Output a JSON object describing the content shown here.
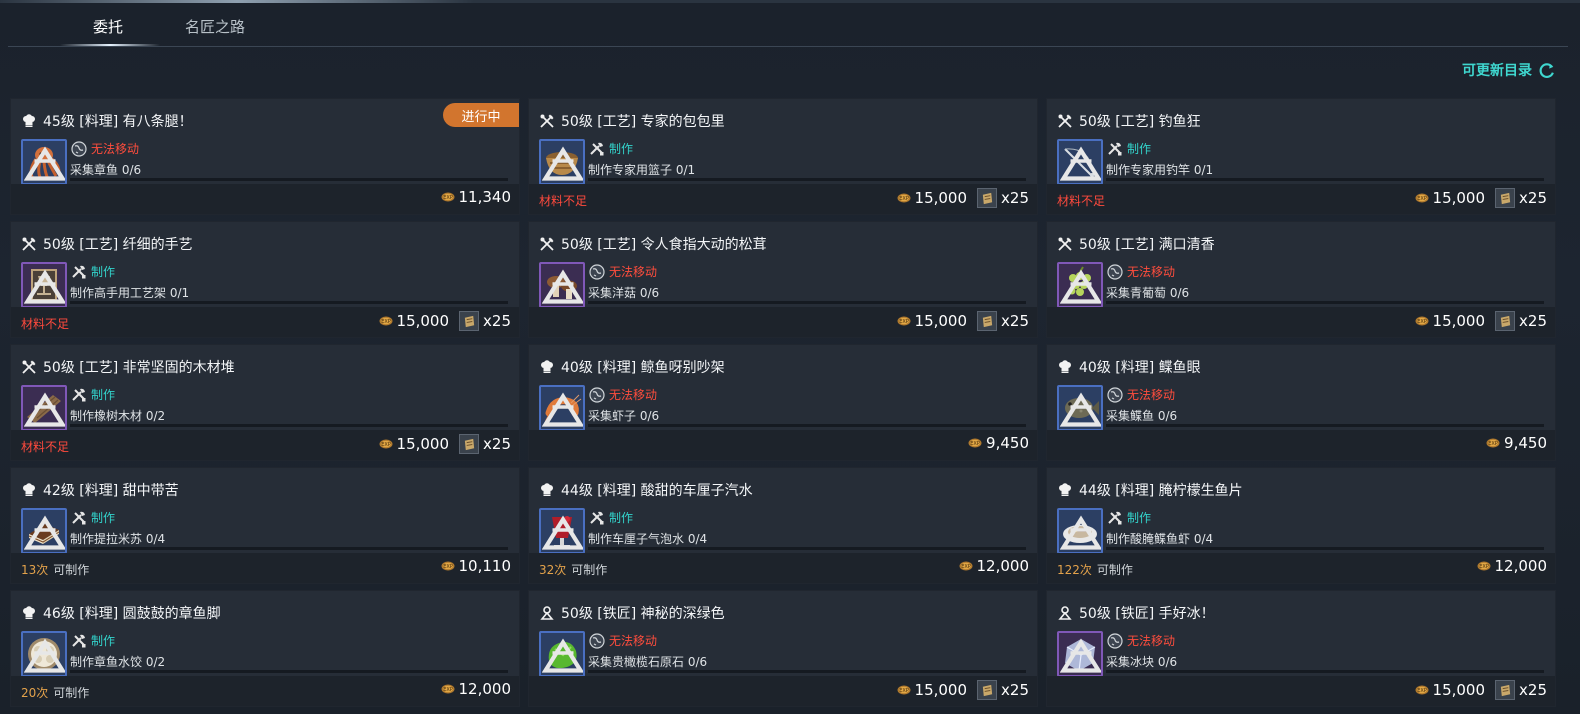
{
  "tabs": [
    {
      "label": "委托",
      "active": true
    },
    {
      "label": "名匠之路",
      "active": false
    }
  ],
  "refresh_label": "可更新目录",
  "colors": {
    "teal": "#33d3cb",
    "red": "#ff4d3d",
    "orange_badge": "#d2752e",
    "gold": "#e3a24b"
  },
  "cards": [
    {
      "type_icon": "chef-hat-icon",
      "title": "45级  [料理] 有八条腿！",
      "badge": "进行中",
      "item_icon": "octopus-icon",
      "item_color": "blue",
      "status_kind": "red",
      "status_icon": "globe-icon",
      "status": "无法移动",
      "objective": "采集章鱼 0/6",
      "left_red": "",
      "count": "",
      "count_label": "",
      "reward": "11,340",
      "multiplier": ""
    },
    {
      "type_icon": "crossed-tools-icon",
      "title": "50级  [工艺] 专家的包包里",
      "badge": "",
      "item_icon": "basket-icon",
      "item_color": "blue",
      "status_kind": "teal",
      "status_icon": "tools-icon",
      "status": "制作",
      "objective": "制作专家用篮子 0/1",
      "left_red": "材料不足",
      "count": "",
      "count_label": "",
      "reward": "15,000",
      "multiplier": "x25"
    },
    {
      "type_icon": "crossed-tools-icon",
      "title": "50级  [工艺] 钓鱼狂",
      "badge": "",
      "item_icon": "fishing-rod-icon",
      "item_color": "blue",
      "status_kind": "teal",
      "status_icon": "tools-icon",
      "status": "制作",
      "objective": "制作专家用钓竿 0/1",
      "left_red": "材料不足",
      "count": "",
      "count_label": "",
      "reward": "15,000",
      "multiplier": "x25"
    },
    {
      "type_icon": "crossed-tools-icon",
      "title": "50级  [工艺] 纤细的手艺",
      "badge": "",
      "item_icon": "craft-frame-icon",
      "item_color": "purple",
      "status_kind": "teal",
      "status_icon": "tools-icon",
      "status": "制作",
      "objective": "制作高手用工艺架 0/1",
      "left_red": "材料不足",
      "count": "",
      "count_label": "",
      "reward": "15,000",
      "multiplier": "x25"
    },
    {
      "type_icon": "crossed-tools-icon",
      "title": "50级  [工艺] 令人食指大动的松茸",
      "badge": "",
      "item_icon": "mushroom-icon",
      "item_color": "purple",
      "status_kind": "red",
      "status_icon": "globe-icon",
      "status": "无法移动",
      "objective": "采集洋菇 0/6",
      "left_red": "",
      "count": "",
      "count_label": "",
      "reward": "15,000",
      "multiplier": "x25"
    },
    {
      "type_icon": "crossed-tools-icon",
      "title": "50级  [工艺] 满口清香",
      "badge": "",
      "item_icon": "grapes-icon",
      "item_color": "purple",
      "status_kind": "red",
      "status_icon": "globe-icon",
      "status": "无法移动",
      "objective": "采集青葡萄 0/6",
      "left_red": "",
      "count": "",
      "count_label": "",
      "reward": "15,000",
      "multiplier": "x25"
    },
    {
      "type_icon": "crossed-tools-icon",
      "title": "50级  [工艺] 非常坚固的木材堆",
      "badge": "",
      "item_icon": "timber-icon",
      "item_color": "purple",
      "status_kind": "teal",
      "status_icon": "tools-icon",
      "status": "制作",
      "objective": "制作橡树木材 0/2",
      "left_red": "材料不足",
      "count": "",
      "count_label": "",
      "reward": "15,000",
      "multiplier": "x25"
    },
    {
      "type_icon": "chef-hat-icon",
      "title": "40级  [料理] 鲸鱼呀别吵架",
      "badge": "",
      "item_icon": "shrimp-icon",
      "item_color": "blue",
      "status_kind": "red",
      "status_icon": "globe-icon",
      "status": "无法移动",
      "objective": "采集虾子 0/6",
      "left_red": "",
      "count": "",
      "count_label": "",
      "reward": "9,450",
      "multiplier": ""
    },
    {
      "type_icon": "chef-hat-icon",
      "title": "40级  [料理] 鲽鱼眼",
      "badge": "",
      "item_icon": "flatfish-icon",
      "item_color": "blue",
      "status_kind": "red",
      "status_icon": "globe-icon",
      "status": "无法移动",
      "objective": "采集鲽鱼 0/6",
      "left_red": "",
      "count": "",
      "count_label": "",
      "reward": "9,450",
      "multiplier": ""
    },
    {
      "type_icon": "chef-hat-icon",
      "title": "42级  [料理] 甜中带苦",
      "badge": "",
      "item_icon": "tiramisu-icon",
      "item_color": "blue",
      "status_kind": "teal",
      "status_icon": "tools-icon",
      "status": "制作",
      "objective": "制作提拉米苏 0/4",
      "left_red": "",
      "count": "13次",
      "count_label": "可制作",
      "reward": "10,110",
      "multiplier": ""
    },
    {
      "type_icon": "chef-hat-icon",
      "title": "44级  [料理] 酸甜的车厘子汽水",
      "badge": "",
      "item_icon": "soda-icon",
      "item_color": "blue",
      "status_kind": "teal",
      "status_icon": "tools-icon",
      "status": "制作",
      "objective": "制作车厘子气泡水 0/4",
      "left_red": "",
      "count": "32次",
      "count_label": "可制作",
      "reward": "12,000",
      "multiplier": ""
    },
    {
      "type_icon": "chef-hat-icon",
      "title": "44级  [料理] 腌柠檬生鱼片",
      "badge": "",
      "item_icon": "sashimi-icon",
      "item_color": "blue",
      "status_kind": "teal",
      "status_icon": "tools-icon",
      "status": "制作",
      "objective": "制作酸腌鲽鱼虾 0/4",
      "left_red": "",
      "count": "122次",
      "count_label": "可制作",
      "reward": "12,000",
      "multiplier": ""
    },
    {
      "type_icon": "chef-hat-icon",
      "title": "46级  [料理] 圆鼓鼓的章鱼脚",
      "badge": "",
      "item_icon": "dumplings-icon",
      "item_color": "blue",
      "status_kind": "teal",
      "status_icon": "tools-icon",
      "status": "制作",
      "objective": "制作章鱼水饺 0/2",
      "left_red": "",
      "count": "20次",
      "count_label": "可制作",
      "reward": "12,000",
      "multiplier": ""
    },
    {
      "type_icon": "anvil-icon",
      "title": "50级  [铁匠] 神秘的深绿色",
      "badge": "",
      "item_icon": "olivine-ore-icon",
      "item_color": "blue",
      "status_kind": "red",
      "status_icon": "globe-icon",
      "status": "无法移动",
      "objective": "采集贵橄榄石原石 0/6",
      "left_red": "",
      "count": "",
      "count_label": "",
      "reward": "15,000",
      "multiplier": "x25"
    },
    {
      "type_icon": "anvil-icon",
      "title": "50级  [铁匠] 手好冰！",
      "badge": "",
      "item_icon": "ice-block-icon",
      "item_color": "purple",
      "status_kind": "red",
      "status_icon": "globe-icon",
      "status": "无法移动",
      "objective": "采集冰块 0/6",
      "left_red": "",
      "count": "",
      "count_label": "",
      "reward": "15,000",
      "multiplier": "x25"
    }
  ]
}
